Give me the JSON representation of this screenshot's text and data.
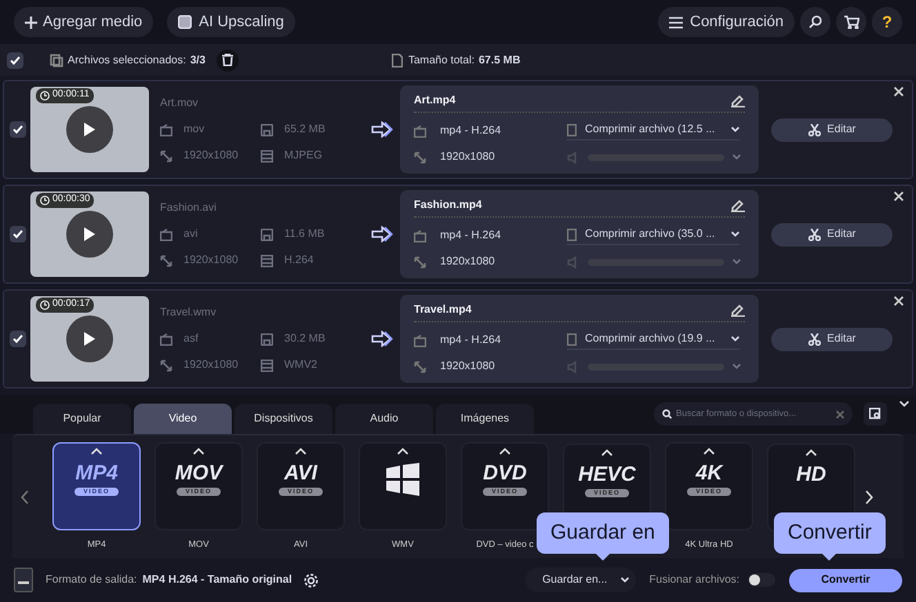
{
  "toolbar": {
    "add_button": "Agregar medio",
    "ai_button": "AI Upscaling",
    "settings_button": "Configuración",
    "help_button": "?"
  },
  "selection_bar": {
    "checked": true,
    "selected_label": "Archivos seleccionados:",
    "selected_count": "3/3",
    "total_label": "Tamaño total:",
    "total_value": "67.5 MB"
  },
  "files": [
    {
      "checked": true,
      "duration": "00:00:11",
      "name": "Art.mov",
      "format": "mov",
      "size": "65.2 MB",
      "resolution": "1920x1080",
      "codec": "MJPEG",
      "output": {
        "name": "Art.mp4",
        "format": "mp4 - H.264",
        "compression": "Comprimir archivo (12.5 ...",
        "resolution": "1920x1080"
      },
      "edit": "Editar"
    },
    {
      "checked": true,
      "duration": "00:00:30",
      "name": "Fashion.avi",
      "format": "avi",
      "size": "11.6 MB",
      "resolution": "1920x1080",
      "codec": "H.264",
      "output": {
        "name": "Fashion.mp4",
        "format": "mp4 - H.264",
        "compression": "Comprimir archivo (35.0 ...",
        "resolution": "1920x1080"
      },
      "edit": "Editar"
    },
    {
      "checked": true,
      "duration": "00:00:17",
      "name": "Travel.wmv",
      "format": "asf",
      "size": "30.2 MB",
      "resolution": "1920x1080",
      "codec": "WMV2",
      "output": {
        "name": "Travel.mp4",
        "format": "mp4 - H.264",
        "compression": "Comprimir archivo (19.9 ...",
        "resolution": "1920x1080"
      },
      "edit": "Editar"
    }
  ],
  "tabs": [
    {
      "label": "Popular",
      "selected": false
    },
    {
      "label": "Video",
      "selected": true
    },
    {
      "label": "Dispositivos",
      "selected": false
    },
    {
      "label": "Audio",
      "selected": false
    },
    {
      "label": "Imágenes",
      "selected": false
    }
  ],
  "search": {
    "placeholder": "Buscar formato o dispositivo..."
  },
  "formats": [
    {
      "kind": "text",
      "logo": "MP4",
      "sub": "VIDEO",
      "label": "MP4",
      "selected": true
    },
    {
      "kind": "text",
      "logo": "MOV",
      "sub": "VIDEO",
      "label": "MOV",
      "selected": false
    },
    {
      "kind": "text",
      "logo": "AVI",
      "sub": "VIDEO",
      "label": "AVI",
      "selected": false
    },
    {
      "kind": "windows",
      "label": "WMV",
      "selected": false
    },
    {
      "kind": "text",
      "logo": "DVD",
      "sub": "VIDEO",
      "label": "DVD – video c",
      "selected": false
    },
    {
      "kind": "text",
      "logo": "HEVC",
      "sub": "VIDEO",
      "selected": false
    },
    {
      "kind": "text",
      "logo": "4K",
      "sub": "VIDEO",
      "label": "4K Ultra HD",
      "selected": false
    },
    {
      "kind": "text",
      "logo": "HD",
      "selected": false
    }
  ],
  "bottom_bar": {
    "output_label": "Formato de salida:",
    "output_value": "MP4 H.264 - Tamaño original",
    "save_button": "Guardar en...",
    "merge_label": "Fusionar archivos:",
    "merge_on": false,
    "convert_button": "Convertir"
  },
  "callouts": [
    {
      "text": "Guardar en"
    },
    {
      "text": "Convertir"
    }
  ]
}
